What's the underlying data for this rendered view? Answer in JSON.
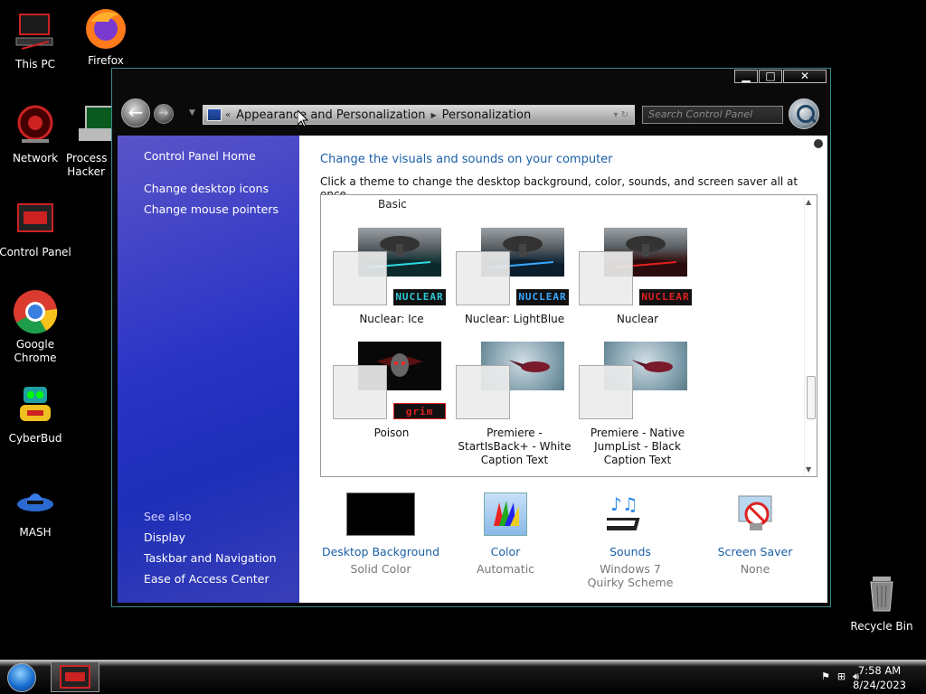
{
  "desktop": {
    "icons": [
      {
        "label": "This PC"
      },
      {
        "label": "Firefox"
      },
      {
        "label": "Network"
      },
      {
        "label": "Process Hacker"
      },
      {
        "label": "Control Panel"
      },
      {
        "label": "Google Chrome"
      },
      {
        "label": "CyberBud"
      },
      {
        "label": "MASH"
      },
      {
        "label": "Recycle Bin"
      }
    ]
  },
  "window": {
    "caption_buttons": {
      "minimize": "▁",
      "maximize": "□",
      "close": "✕"
    },
    "address": {
      "chevron": "«",
      "crumbs": [
        "Appearance and Personalization",
        "Personalization"
      ],
      "separator": "▶"
    },
    "search": {
      "placeholder": "Search Control Panel"
    },
    "left_pane": {
      "home": "Control Panel Home",
      "links": [
        "Change desktop icons",
        "Change mouse pointers"
      ],
      "see_also_heading": "See also",
      "see_also": [
        "Display",
        "Taskbar and Navigation",
        "Ease of Access Center"
      ]
    },
    "content": {
      "heading": "Change the visuals and sounds on your computer",
      "subheading": "Click a theme to change the desktop background, color, sounds, and screen saver all at once.",
      "group_label": "Basic",
      "themes": [
        {
          "name": "Nuclear: Ice",
          "badge": "NUCLEAR",
          "badge_color": "#2ec8d8"
        },
        {
          "name": "Nuclear: LightBlue",
          "badge": "NUCLEAR",
          "badge_color": "#3aa8ff"
        },
        {
          "name": "Nuclear",
          "badge": "NUCLEAR",
          "badge_color": "#e02020"
        },
        {
          "name": "Poison",
          "badge": "grim",
          "badge_color": "#e02020"
        },
        {
          "name": "Premiere - StartIsBack+ - White Caption Text",
          "badge": "",
          "badge_color": ""
        },
        {
          "name": "Premiere - Native JumpList - Black Caption Text",
          "badge": "",
          "badge_color": ""
        }
      ],
      "options": [
        {
          "title": "Desktop Background",
          "value": "Solid Color"
        },
        {
          "title": "Color",
          "value": "Automatic"
        },
        {
          "title": "Sounds",
          "value": "Windows 7 Quirky Scheme"
        },
        {
          "title": "Screen Saver",
          "value": "None"
        }
      ]
    }
  },
  "taskbar": {
    "time": "7:58 AM",
    "date": "8/24/2023"
  }
}
